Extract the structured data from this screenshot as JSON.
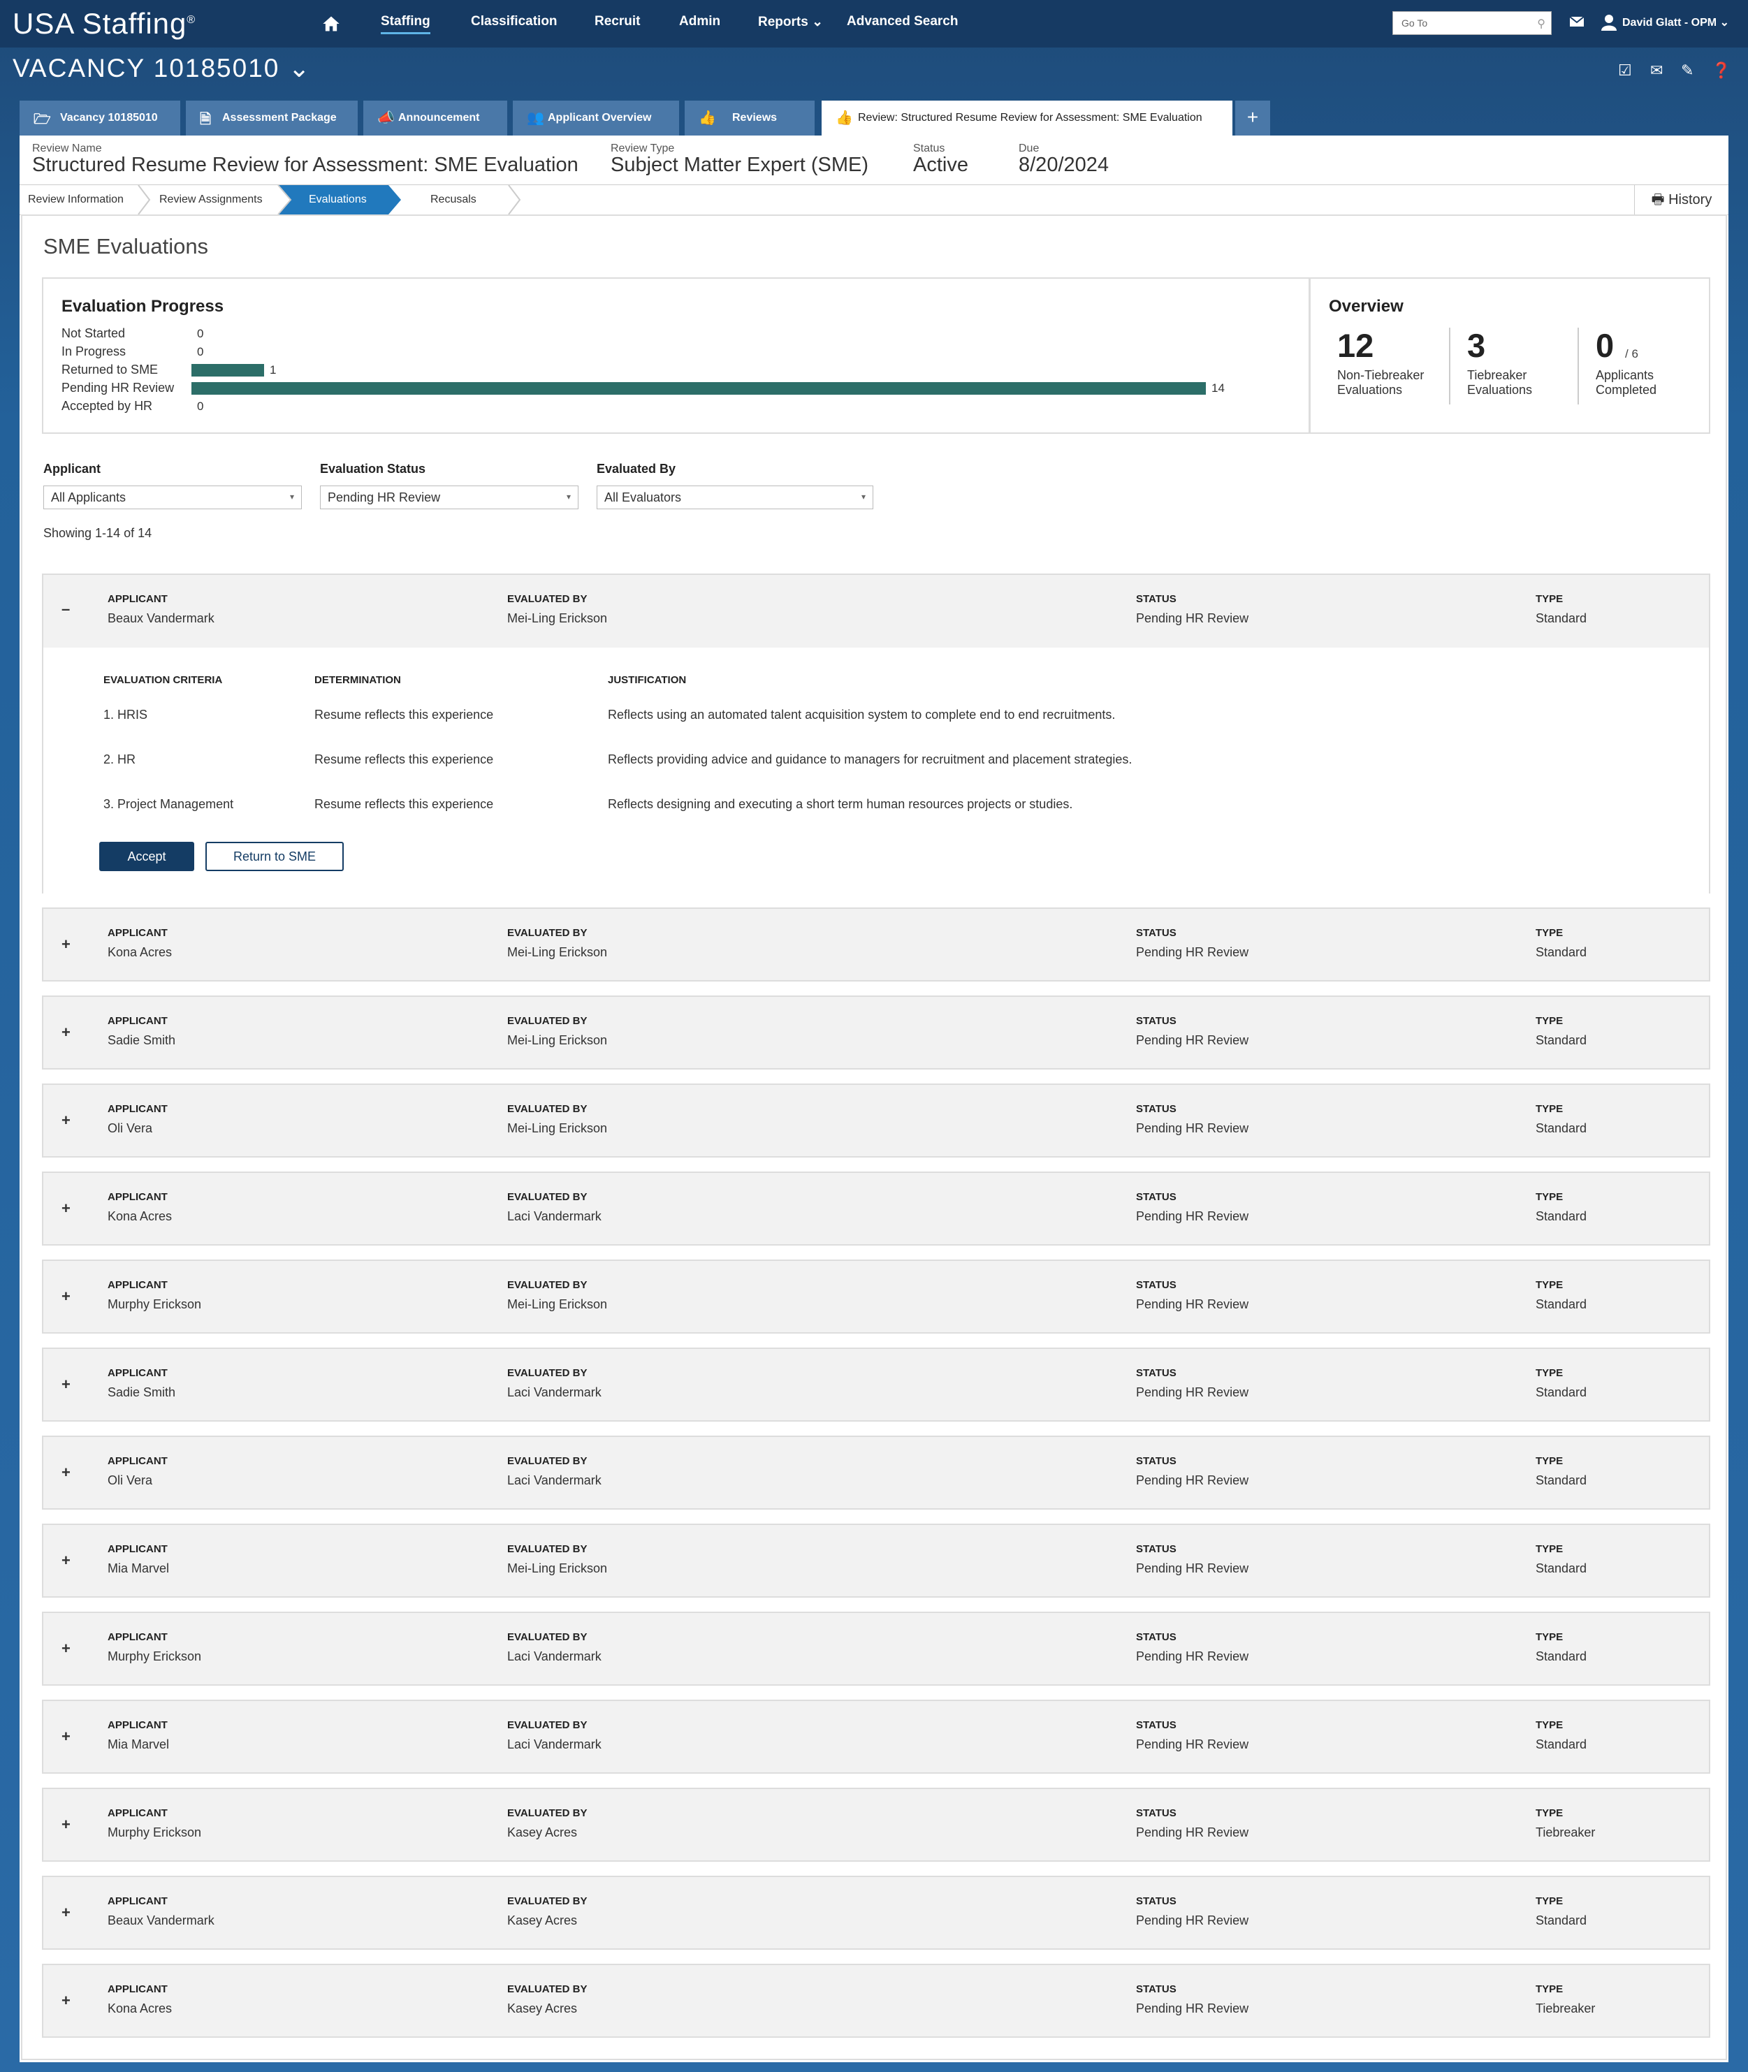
{
  "app": {
    "logo": "USA Staffing",
    "logo_mark": "®"
  },
  "nav": {
    "items": [
      "Staffing",
      "Classification",
      "Recruit",
      "Admin",
      "Reports",
      "Advanced Search"
    ],
    "reports_caret": "⌄",
    "goto_placeholder": "Go To",
    "user": "David Glatt - OPM"
  },
  "vacancy": {
    "title": "VACANCY 10185010",
    "caret": "⌄"
  },
  "tabs": [
    {
      "label": "Vacancy 10185010",
      "icon": "folder-icon"
    },
    {
      "label": "Assessment Package",
      "icon": "document-icon"
    },
    {
      "label": "Announcement",
      "icon": "megaphone-icon"
    },
    {
      "label": "Applicant Overview",
      "icon": "people-icon"
    },
    {
      "label": "Reviews",
      "icon": "thumbs-up-icon"
    },
    {
      "label": "Review: Structured Resume Review for Assessment: SME Evaluation",
      "icon": "thumbs-up-icon"
    }
  ],
  "review": {
    "name_label": "Review Name",
    "name": "Structured Resume Review for Assessment: SME Evaluation",
    "type_label": "Review Type",
    "type": "Subject Matter Expert (SME)",
    "status_label": "Status",
    "status": "Active",
    "due_label": "Due",
    "due": "8/20/2024"
  },
  "steps": [
    "Review Information",
    "Review Assignments",
    "Evaluations",
    "Recusals"
  ],
  "active_step": "Evaluations",
  "history_label": "History",
  "page_title": "SME Evaluations",
  "progress": {
    "title": "Evaluation Progress",
    "rows": [
      {
        "label": "Not Started",
        "count": "0",
        "value": 0
      },
      {
        "label": "In Progress",
        "count": "0",
        "value": 0
      },
      {
        "label": "Returned to SME",
        "count": "1",
        "value": 1
      },
      {
        "label": "Pending HR Review",
        "count": "14",
        "value": 14
      },
      {
        "label": "Accepted by HR",
        "count": "0",
        "value": 0
      }
    ],
    "bar_color": "#2c6e68"
  },
  "overview": {
    "title": "Overview",
    "stats": [
      {
        "num": "12",
        "sub": "",
        "label1": "Non-Tiebreaker",
        "label2": "Evaluations"
      },
      {
        "num": "3",
        "sub": "",
        "label1": "Tiebreaker",
        "label2": "Evaluations"
      },
      {
        "num": "0",
        "sub": "/ 6",
        "label1": "Applicants",
        "label2": "Completed"
      }
    ]
  },
  "filters": {
    "applicant_label": "Applicant",
    "applicant_value": "All Applicants",
    "status_label": "Evaluation Status",
    "status_value": "Pending HR Review",
    "evaluator_label": "Evaluated By",
    "evaluator_value": "All Evaluators",
    "caret": "▾"
  },
  "showing": "Showing 1-14 of 14",
  "col_headers": {
    "applicant": "APPLICANT",
    "evaluated_by": "EVALUATED BY",
    "status": "STATUS",
    "type": "TYPE"
  },
  "expanded_headers": {
    "criteria": "EVALUATION CRITERIA",
    "determination": "DETERMINATION",
    "justification": "JUSTIFICATION"
  },
  "criteria": [
    {
      "criteria": "1. HRIS",
      "determination": "Resume reflects this experience",
      "justification": "Reflects using an automated talent acquisition system to complete end to end recruitments."
    },
    {
      "criteria": "2. HR",
      "determination": "Resume reflects this experience",
      "justification": "Reflects providing advice and guidance to managers for recruitment and placement strategies."
    },
    {
      "criteria": "3. Project Management",
      "determination": "Resume reflects this experience",
      "justification": "Reflects designing and executing a short term human resources projects or studies."
    }
  ],
  "actions": {
    "accept": "Accept",
    "return": "Return to SME"
  },
  "toggle": {
    "expanded": "–",
    "collapsed": "+"
  },
  "evaluations": [
    {
      "applicant": "Beaux Vandermark",
      "evaluator": "Mei-Ling Erickson",
      "status": "Pending HR Review",
      "type": "Standard"
    },
    {
      "applicant": "Kona Acres",
      "evaluator": "Mei-Ling Erickson",
      "status": "Pending HR Review",
      "type": "Standard"
    },
    {
      "applicant": "Sadie Smith",
      "evaluator": "Mei-Ling Erickson",
      "status": "Pending HR Review",
      "type": "Standard"
    },
    {
      "applicant": "Oli Vera",
      "evaluator": "Mei-Ling Erickson",
      "status": "Pending HR Review",
      "type": "Standard"
    },
    {
      "applicant": "Kona Acres",
      "evaluator": "Laci Vandermark",
      "status": "Pending HR Review",
      "type": "Standard"
    },
    {
      "applicant": "Murphy Erickson",
      "evaluator": "Mei-Ling Erickson",
      "status": "Pending HR Review",
      "type": "Standard"
    },
    {
      "applicant": "Sadie Smith",
      "evaluator": "Laci Vandermark",
      "status": "Pending HR Review",
      "type": "Standard"
    },
    {
      "applicant": "Oli Vera",
      "evaluator": "Laci Vandermark",
      "status": "Pending HR Review",
      "type": "Standard"
    },
    {
      "applicant": "Mia Marvel",
      "evaluator": "Mei-Ling Erickson",
      "status": "Pending HR Review",
      "type": "Standard"
    },
    {
      "applicant": "Murphy Erickson",
      "evaluator": "Laci Vandermark",
      "status": "Pending HR Review",
      "type": "Standard"
    },
    {
      "applicant": "Mia Marvel",
      "evaluator": "Laci Vandermark",
      "status": "Pending HR Review",
      "type": "Standard"
    },
    {
      "applicant": "Murphy Erickson",
      "evaluator": "Kasey Acres",
      "status": "Pending HR Review",
      "type": "Tiebreaker"
    },
    {
      "applicant": "Beaux Vandermark",
      "evaluator": "Kasey Acres",
      "status": "Pending HR Review",
      "type": "Standard"
    },
    {
      "applicant": "Kona Acres",
      "evaluator": "Kasey Acres",
      "status": "Pending HR Review",
      "type": "Tiebreaker"
    }
  ]
}
